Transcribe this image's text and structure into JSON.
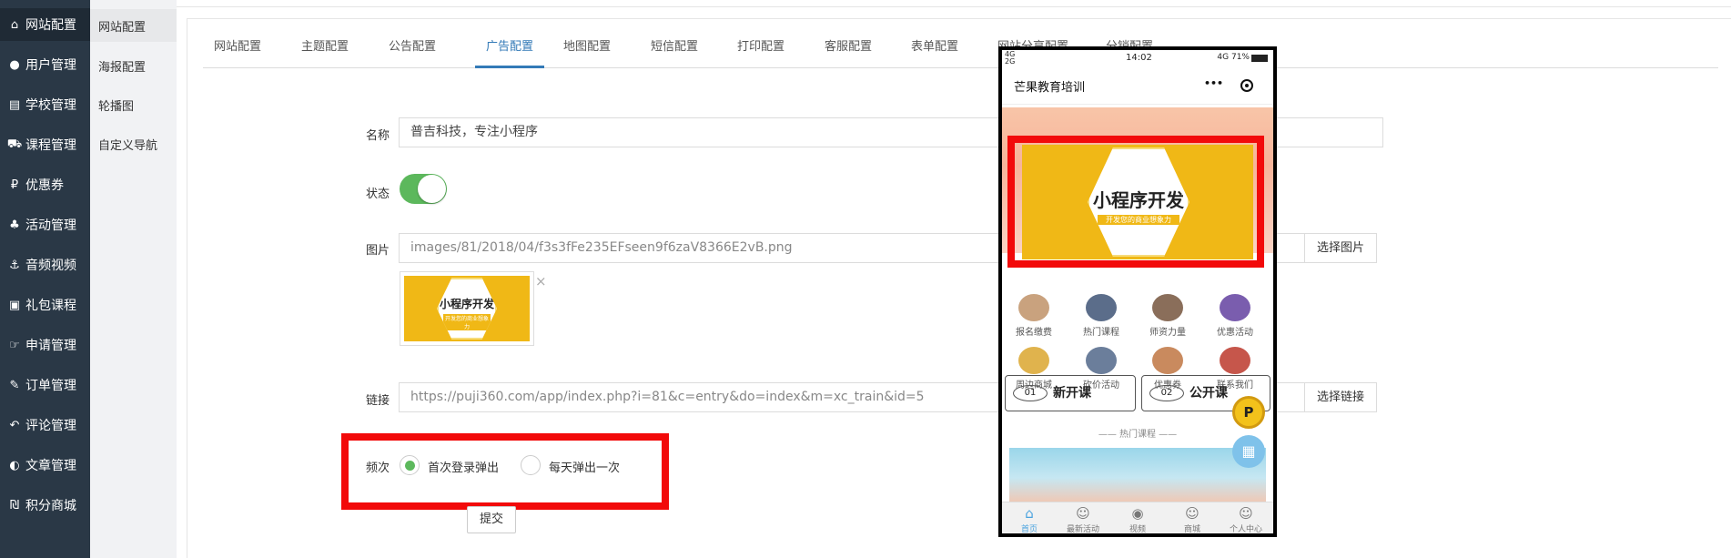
{
  "sidebar": {
    "items": [
      {
        "icon": "home-icon",
        "glyph": "⌂",
        "label": "网站配置"
      },
      {
        "icon": "user-icon",
        "glyph": "●",
        "label": "用户管理"
      },
      {
        "icon": "server-icon",
        "glyph": "▤",
        "label": "学校管理"
      },
      {
        "icon": "cart-icon",
        "glyph": "⛟",
        "label": "课程管理"
      },
      {
        "icon": "coupon-icon",
        "glyph": "₽",
        "label": "优惠券"
      },
      {
        "icon": "activity-icon",
        "glyph": "♣",
        "label": "活动管理"
      },
      {
        "icon": "anchor-icon",
        "glyph": "⚓",
        "label": "音频视频"
      },
      {
        "icon": "gift-icon",
        "glyph": "▣",
        "label": "礼包课程"
      },
      {
        "icon": "hand-icon",
        "glyph": "☞",
        "label": "申请管理"
      },
      {
        "icon": "order-icon",
        "glyph": "✎",
        "label": "订单管理"
      },
      {
        "icon": "reply-icon",
        "glyph": "↶",
        "label": "评论管理"
      },
      {
        "icon": "article-icon",
        "glyph": "◐",
        "label": "文章管理"
      },
      {
        "icon": "points-icon",
        "glyph": "₪",
        "label": "积分商城"
      }
    ]
  },
  "subnav": {
    "items": [
      "网站配置",
      "海报配置",
      "轮播图",
      "自定义导航"
    ]
  },
  "tabs": [
    "网站配置",
    "主题配置",
    "公告配置",
    "广告配置",
    "地图配置",
    "短信配置",
    "打印配置",
    "客服配置",
    "表单配置",
    "网站分享配置",
    "分销配置"
  ],
  "form": {
    "name_label": "名称",
    "name_value": "普吉科技，专注小程序",
    "status_label": "状态",
    "image_label": "图片",
    "image_value": "images/81/2018/04/f3s3fFe235EFseen9f6zaV8366E2vB.png",
    "choose_image": "选择图片",
    "link_label": "链接",
    "link_value": "https://puji360.com/app/index.php?i=81&c=entry&do=index&m=xc_train&id=5",
    "choose_link": "选择链接",
    "freq_label": "频次",
    "freq_option_1": "首次登录弹出",
    "freq_option_2": "每天弹出一次",
    "submit": "提交",
    "close": "×"
  },
  "ad": {
    "title": "小程序开发",
    "subtitle": "开发您的商业想象力"
  },
  "phone": {
    "signal_top": "4G",
    "signal_bottom": "2G",
    "time": "14:02",
    "battery": "4G 71%",
    "app_title": "芒果教育培训",
    "menu_dots": "•••",
    "icons_row1": [
      "报名缴费",
      "热门课程",
      "师资力量",
      "优惠活动"
    ],
    "icons_row2": [
      "周边商城",
      "砍价活动",
      "优惠券",
      "联系我们"
    ],
    "course_1": "新开课",
    "course_1_num": "01",
    "course_2": "公开课",
    "course_2_num": "02",
    "hot_title": "热门课程",
    "tabbar": [
      "首页",
      "最新活动",
      "视频",
      "商城",
      "个人中心"
    ],
    "fab_p": "P"
  },
  "colors": {
    "sidebar_bg": "#2a3846",
    "accent": "#337ab7",
    "toggle_on": "#5cb85c",
    "highlight_red": "#f20a0a",
    "ad_yellow": "#f0b816"
  }
}
